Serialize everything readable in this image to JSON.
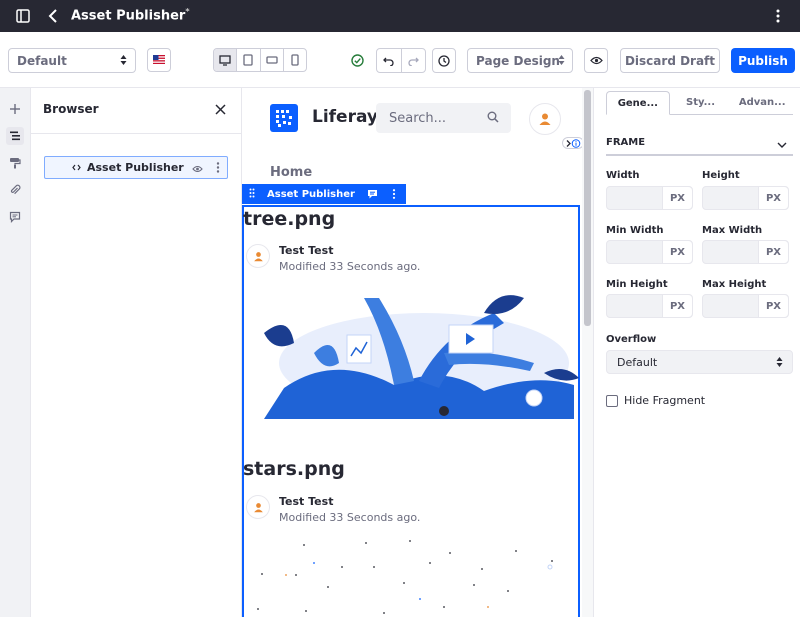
{
  "app": {
    "title": "Asset Publisher",
    "title_marker": "*"
  },
  "toolbar": {
    "experience": "Default",
    "locale_flag_icon": "us-flag-icon",
    "status_icon": "check-circle-icon",
    "page_design_label": "Page Design",
    "discard_label": "Discard Draft",
    "publish_label": "Publish"
  },
  "browser": {
    "title": "Browser",
    "items": [
      {
        "label": "Asset Publisher"
      }
    ]
  },
  "page": {
    "brand": "Liferay",
    "search_placeholder": "Search...",
    "nav_home": "Home",
    "fragment_label": "Asset Publisher",
    "assets": [
      {
        "title": "tree.png",
        "author": "Test Test",
        "meta": "Modified 33 Seconds ago."
      },
      {
        "title": "stars.png",
        "author": "Test Test",
        "meta": "Modified 33 Seconds ago."
      }
    ]
  },
  "panel": {
    "tabs": [
      "Gene...",
      "Sty...",
      "Advan..."
    ],
    "section": "FRAME",
    "width_label": "Width",
    "height_label": "Height",
    "min_width_label": "Min Width",
    "max_width_label": "Max Width",
    "min_height_label": "Min Height",
    "max_height_label": "Max Height",
    "unit": "PX",
    "overflow_label": "Overflow",
    "overflow_value": "Default",
    "hide_fragment_label": "Hide Fragment"
  },
  "colors": {
    "accent": "#0b5fff",
    "topbar": "#272833",
    "avatar": "#e98a33"
  }
}
